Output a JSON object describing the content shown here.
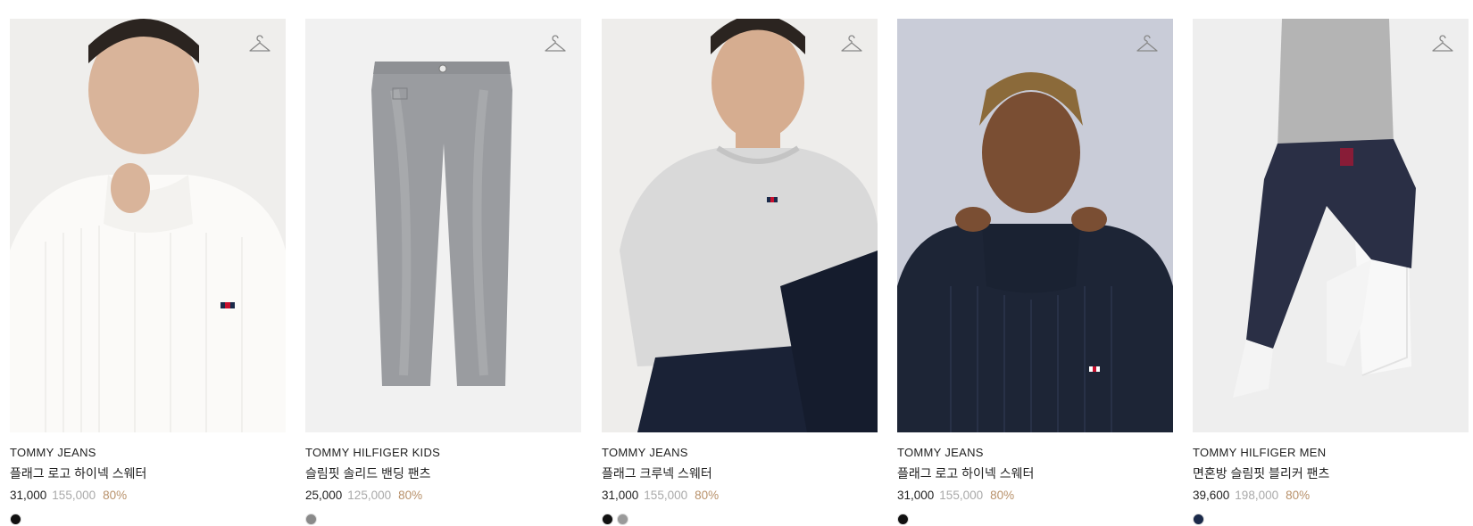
{
  "products": [
    {
      "brand": "TOMMY JEANS",
      "name": "플래그 로고 하이넥 스웨터",
      "sale_price": "31,000",
      "original_price": "155,000",
      "discount": "80%",
      "image": "model-white-high-neck-sweater",
      "swatches": [
        "#111111"
      ]
    },
    {
      "brand": "TOMMY HILFIGER KIDS",
      "name": "슬림핏 솔리드 밴딩 팬츠",
      "sale_price": "25,000",
      "original_price": "125,000",
      "discount": "80%",
      "image": "grey-slim-denim-pants",
      "swatches": [
        "#8a8a8a"
      ]
    },
    {
      "brand": "TOMMY JEANS",
      "name": "플래그 크루넥 스웨터",
      "sale_price": "31,000",
      "original_price": "155,000",
      "discount": "80%",
      "image": "model-grey-crew-neck-sweater",
      "swatches": [
        "#111111",
        "#9a9a9a"
      ]
    },
    {
      "brand": "TOMMY JEANS",
      "name": "플래그 로고 하이넥 스웨터",
      "sale_price": "31,000",
      "original_price": "155,000",
      "discount": "80%",
      "image": "model-navy-high-neck-sweater",
      "swatches": [
        "#111111"
      ]
    },
    {
      "brand": "TOMMY HILFIGER MEN",
      "name": "면혼방 슬림핏 블리커 팬츠",
      "sale_price": "39,600",
      "original_price": "198,000",
      "discount": "80%",
      "image": "model-navy-check-pants",
      "swatches": [
        "#1b2a4a"
      ]
    }
  ],
  "icons": {
    "wishlist": "hanger-icon"
  },
  "colors": {
    "discount": "#b8916a",
    "original_price": "#a9a9a9",
    "text": "#222222"
  }
}
